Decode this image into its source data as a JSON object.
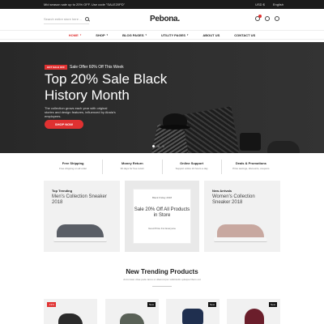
{
  "topbar": {
    "promo_text": "Mid season sale up to 20% OFF. Use code \"SALE20PD\"",
    "currency": "USD $",
    "language": "English"
  },
  "header": {
    "search_placeholder": "Search entire store here ...",
    "logo": "Pebona."
  },
  "nav": {
    "items": [
      {
        "label": "HOME"
      },
      {
        "label": "SHOP"
      },
      {
        "label": "BLOG PAGES"
      },
      {
        "label": "UTILITY PAGES"
      },
      {
        "label": "ABOUT US"
      },
      {
        "label": "CONTACT US"
      }
    ]
  },
  "hero": {
    "badge_tag": "HOT SALE OFF",
    "badge_text": "Sale Offer 60% Off This Week",
    "title": "Top 20% Sale Black History Month",
    "description": "The collection grows each year with original stories and design features, influenced by Abala's employees.",
    "button": "SHOP NOW"
  },
  "features": [
    {
      "title": "Free Shipping",
      "subtitle": "Free shipping on all order"
    },
    {
      "title": "Money Return",
      "subtitle": "30 days for free return"
    },
    {
      "title": "Online Support",
      "subtitle": "Support online 24 hours a day"
    },
    {
      "title": "Deals & Promotions",
      "subtitle": "Price savings, discounts, coupons"
    }
  ],
  "promos": {
    "left": {
      "label": "Top Trending",
      "title": "Men's Collection Sneaker 2018"
    },
    "middle": {
      "line1": "Black Friday 2018",
      "line2": "Sale 20% Off All Products in Store",
      "line3": "Good Price For Everyone"
    },
    "right": {
      "label": "New Arrivals",
      "title": "Women's Collection Sneaker 2018"
    }
  },
  "trending": {
    "title": "New Trending Products",
    "subtitle": "Accumsan vitae pede lacus ut ullamcorper sollicitudin quisque libero est"
  },
  "products": [
    {
      "badge": "-19%"
    },
    {
      "badge": "New"
    },
    {
      "badge": "New"
    },
    {
      "badge": "New"
    }
  ]
}
